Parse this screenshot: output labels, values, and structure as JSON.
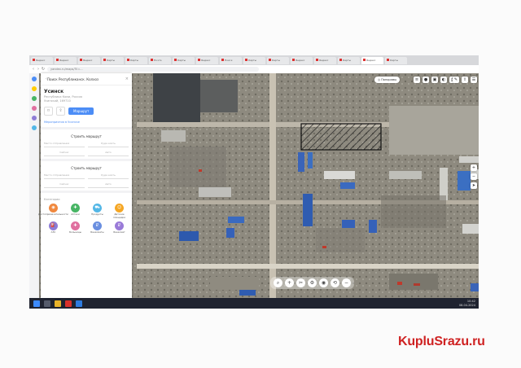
{
  "browser": {
    "tabs": [
      "Яндекс",
      "Яндекс",
      "Яндекс",
      "Карты",
      "Карты",
      "Почта",
      "Карты",
      "Яндекс",
      "Поиск",
      "Карты",
      "Карты",
      "Яндекс",
      "Яндекс",
      "Карты",
      "Яндекс",
      "Карты"
    ],
    "url": "yandex.ru/maps/?ll=..."
  },
  "panel": {
    "header": "Поиск Республиканск. Колхоз",
    "title": "Усинск",
    "subtitle_1": "Республика Коми, Россия",
    "subtitle_2": "Усинский, 169710",
    "route_label": "Маршрут",
    "link": "Мероприятия в Усинске",
    "route_section_1": "Строить маршрут",
    "route_section_2": "Строить маршрут",
    "field_from": "Место отправления",
    "field_to": "Куда ехать",
    "field_time": "Сейчас",
    "field_mode": "Авто",
    "categories_title": "Категории",
    "categories": [
      {
        "label": "Достопримечательности",
        "color": "#f0883e",
        "icon": "camera-icon"
      },
      {
        "label": "Аптеки",
        "color": "#47b564",
        "icon": "pharmacy-icon"
      },
      {
        "label": "Продукты",
        "color": "#53b7e6",
        "icon": "cart-icon"
      },
      {
        "label": "Детские площадки",
        "color": "#f5a623",
        "icon": "playground-icon"
      },
      {
        "label": "АЗС",
        "color": "#8e7cd6",
        "icon": "fuel-icon"
      },
      {
        "label": "Больницы",
        "color": "#e06f9f",
        "icon": "hospital-icon"
      },
      {
        "label": "Банкоматы",
        "color": "#6a8fe0",
        "icon": "atm-icon"
      },
      {
        "label": "Банкомат",
        "color": "#9a7bd8",
        "icon": "bank-icon"
      }
    ]
  },
  "map": {
    "layer_label": "Панорамы",
    "top_icons": [
      "layers-icon",
      "traffic-icon",
      "bus-icon",
      "panorama-icon",
      "print-icon"
    ],
    "bottom_tools": [
      "search-icon",
      "zoom-in-icon",
      "ruler-icon",
      "gear-icon",
      "camera-icon",
      "route-icon",
      "zoom-out-icon"
    ]
  },
  "taskbar": {
    "time": "10:42",
    "date": "08.04.2024"
  },
  "watermark": "KupluSrazu.ru"
}
